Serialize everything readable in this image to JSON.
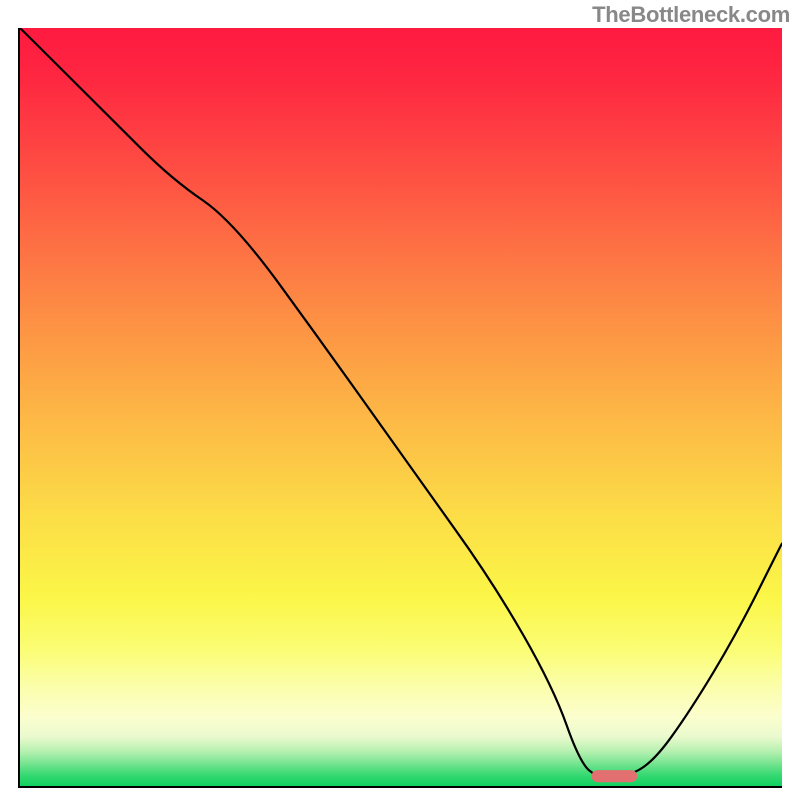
{
  "watermark": "TheBottleneck.com",
  "chart_data": {
    "type": "line",
    "title": "",
    "xlabel": "",
    "ylabel": "",
    "xlim": [
      0,
      100
    ],
    "ylim": [
      0,
      100
    ],
    "grid": false,
    "background_gradient": {
      "stops": [
        {
          "offset": 0.0,
          "color": "#FE1A40"
        },
        {
          "offset": 0.07,
          "color": "#FE2841"
        },
        {
          "offset": 0.2,
          "color": "#FE5243"
        },
        {
          "offset": 0.35,
          "color": "#FD8544"
        },
        {
          "offset": 0.5,
          "color": "#FDB445"
        },
        {
          "offset": 0.64,
          "color": "#FCDC47"
        },
        {
          "offset": 0.75,
          "color": "#FBF647"
        },
        {
          "offset": 0.82,
          "color": "#FBFD74"
        },
        {
          "offset": 0.87,
          "color": "#FBFEAB"
        },
        {
          "offset": 0.91,
          "color": "#FBFECE"
        },
        {
          "offset": 0.935,
          "color": "#EAFACE"
        },
        {
          "offset": 0.955,
          "color": "#B4F0AF"
        },
        {
          "offset": 0.972,
          "color": "#70E38D"
        },
        {
          "offset": 0.985,
          "color": "#38D973"
        },
        {
          "offset": 1.0,
          "color": "#0FD25F"
        }
      ]
    },
    "series": [
      {
        "name": "bottleneck-curve",
        "x": [
          0,
          5,
          12,
          20,
          28,
          40,
          52,
          62,
          70,
          73.5,
          76,
          79,
          83,
          88,
          94,
          100
        ],
        "y": [
          100,
          95,
          88,
          80,
          74.5,
          58,
          41,
          27,
          13,
          3,
          1,
          1,
          3,
          10,
          20,
          32
        ]
      }
    ],
    "marker": {
      "name": "optimum-range",
      "shape": "rounded-bar",
      "x_center": 78,
      "y_center": 1.3,
      "width": 6,
      "height": 1.6,
      "color": "#E27070"
    },
    "annotations": []
  }
}
